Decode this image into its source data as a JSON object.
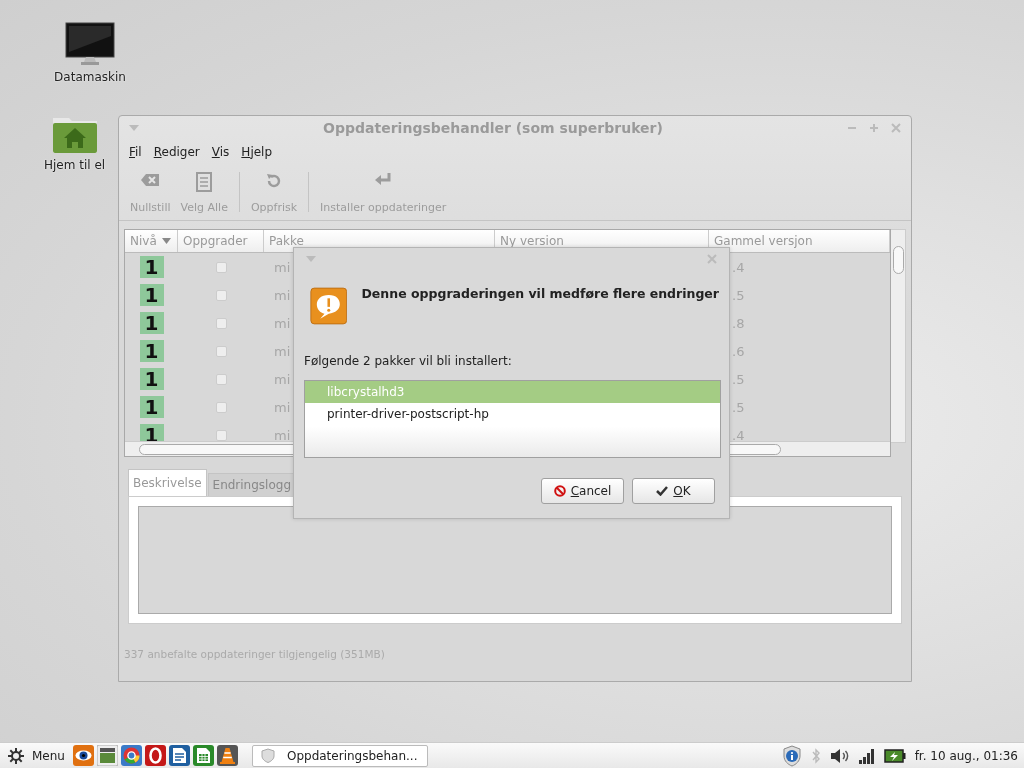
{
  "desktop_icons": [
    {
      "label": "Datamaskin",
      "kind": "computer"
    },
    {
      "label": "Hjem til el",
      "kind": "home"
    }
  ],
  "window": {
    "title": "Oppdateringsbehandler (som superbruker)",
    "menu": [
      "Fil",
      "Rediger",
      "Vis",
      "Hjelp"
    ],
    "toolbar": [
      {
        "label": "Nullstill",
        "kind": "clear",
        "disabled": true
      },
      {
        "label": "Velg Alle",
        "kind": "select-all",
        "disabled": true
      },
      {
        "label": "Oppfrisk",
        "kind": "refresh",
        "disabled": true
      },
      {
        "label": "Installer oppdateringer",
        "kind": "install",
        "disabled": true
      }
    ],
    "table": {
      "columns": [
        "Nivå",
        "Oppgrader",
        "Pakke",
        "Ny version",
        "Gammel versjon"
      ],
      "rows": [
        {
          "level": "1",
          "checked": false,
          "package": "mi",
          "old_version": ".4"
        },
        {
          "level": "1",
          "checked": false,
          "package": "mi",
          "old_version": ".5"
        },
        {
          "level": "1",
          "checked": false,
          "package": "mi",
          "old_version": ".8"
        },
        {
          "level": "1",
          "checked": false,
          "package": "mi",
          "old_version": ".6"
        },
        {
          "level": "1",
          "checked": false,
          "package": "mi",
          "old_version": ".5"
        },
        {
          "level": "1",
          "checked": false,
          "package": "mi",
          "old_version": ".5"
        },
        {
          "level": "1",
          "checked": false,
          "package": "mi",
          "old_version": ".4"
        }
      ]
    },
    "tabs": [
      {
        "label": "Beskrivelse",
        "selected": true
      },
      {
        "label": "Endringslogg",
        "selected": false
      }
    ],
    "status_bar": "337 anbefalte oppdateringer tilgjengelig (351MB)"
  },
  "dialog": {
    "heading": "Denne oppgraderingen vil medføre flere endringer",
    "message": "Følgende 2 pakker vil bli installert:",
    "packages": [
      {
        "name": "libcrystalhd3",
        "selected": true
      },
      {
        "name": "printer-driver-postscript-hp",
        "selected": false
      }
    ],
    "buttons": [
      {
        "label": "Cancel",
        "kind": "cancel"
      },
      {
        "label": "OK",
        "kind": "ok"
      }
    ]
  },
  "taskbar": {
    "menu_label": "Menu",
    "launchers": [
      {
        "kind": "eye"
      },
      {
        "kind": "terminal"
      },
      {
        "kind": "browser"
      },
      {
        "kind": "opera"
      },
      {
        "kind": "writer"
      },
      {
        "kind": "calc"
      },
      {
        "kind": "cone"
      }
    ],
    "window_button": "Oppdateringsbehan...",
    "clock": "fr. 10 aug., 01:36"
  }
}
